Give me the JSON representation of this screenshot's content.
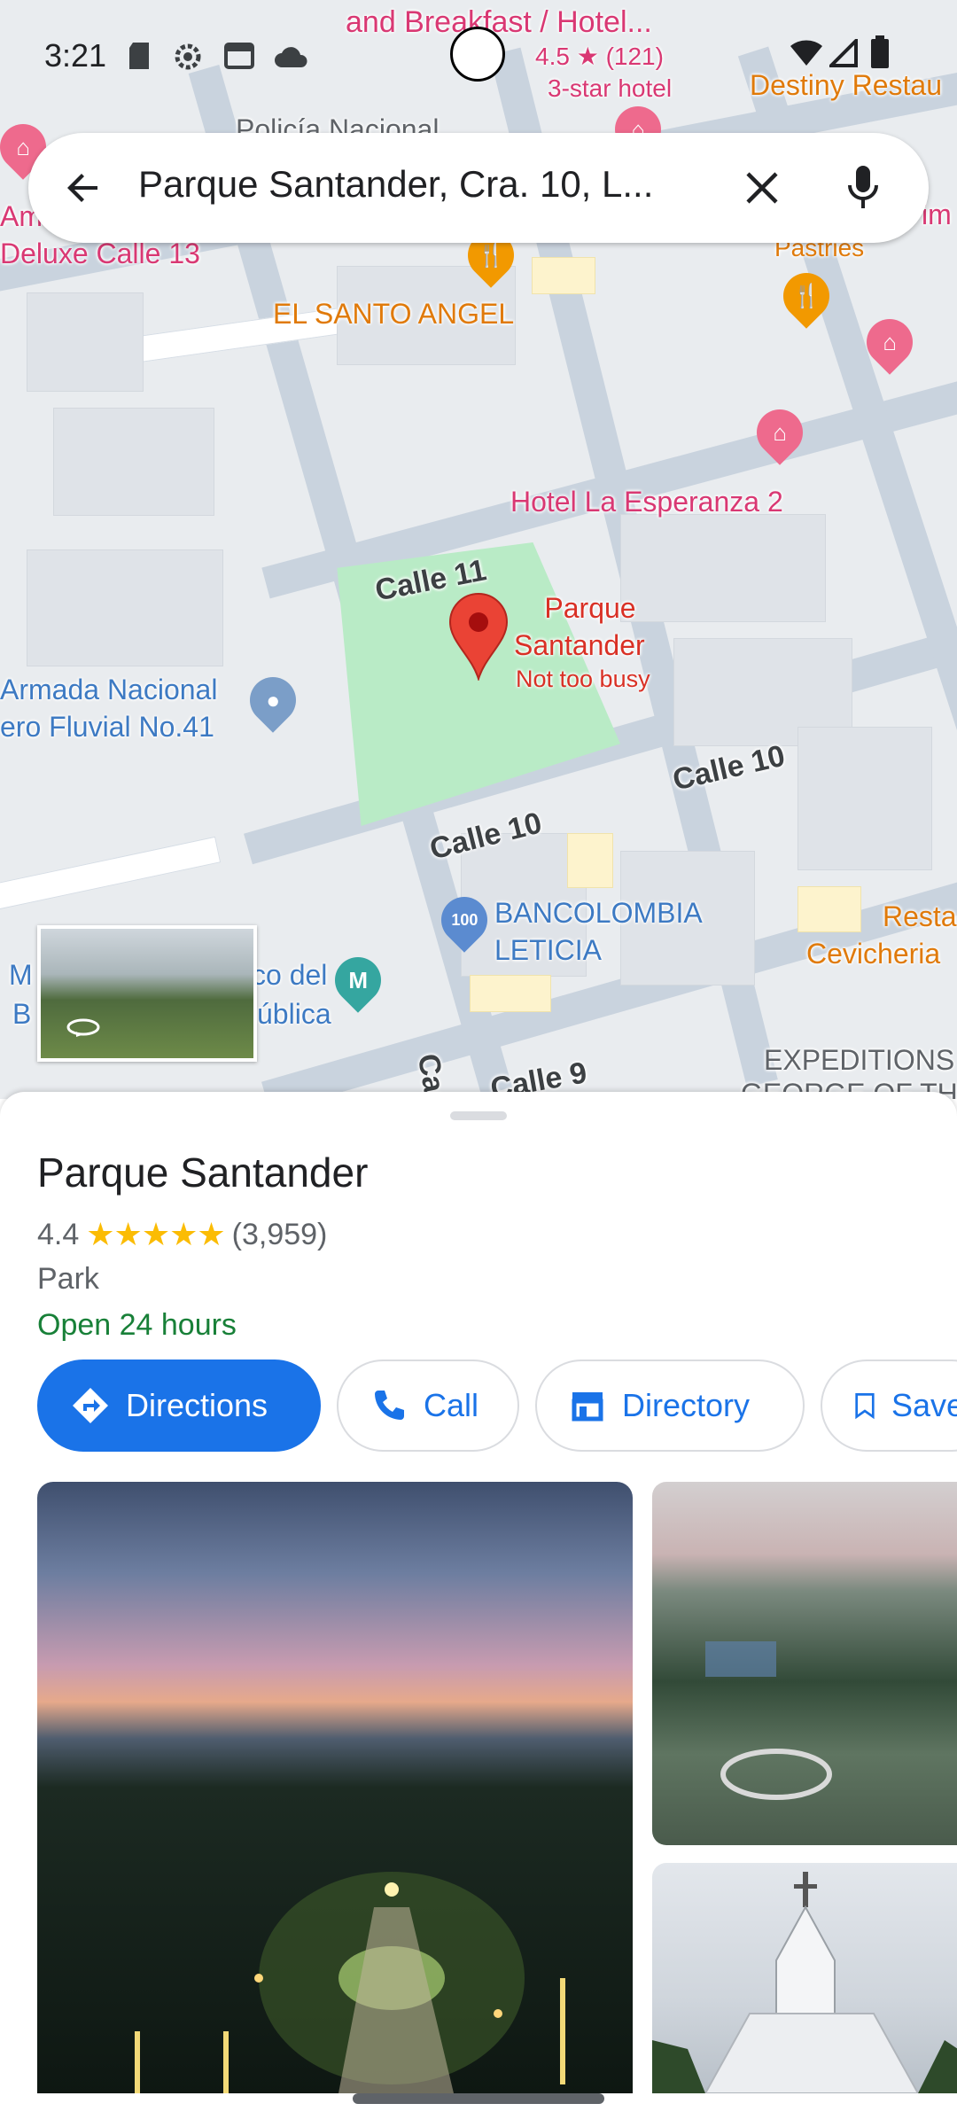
{
  "status_bar": {
    "time": "3:21"
  },
  "search": {
    "query": "Parque Santander, Cra. 10, L..."
  },
  "map": {
    "top_hotel": {
      "name": "and Breakfast / Hotel...",
      "rating": "4.5 ★ (121)",
      "class": "3-star hotel"
    },
    "labels": {
      "destiny": "Destiny Restau",
      "policia": "Policía Nacional",
      "deluxe_a": "Am",
      "deluxe_b": "Deluxe Calle 13",
      "pastries": "Pastries",
      "right_edge": "im",
      "santo_angel": "EL SANTO ANGEL",
      "esperanza": "Hotel La Esperanza 2",
      "park_name_1": "Parque",
      "park_name_2": "Santander",
      "park_busy": "Not too busy",
      "armada_1": "Armada Nacional",
      "armada_2": "ero Fluvial No.41",
      "bank_1": "BANCOLOMBIA",
      "bank_2": "LETICIA",
      "museo_a1": "M",
      "museo_a2": "B",
      "museo_b1": "co del",
      "museo_b2": "ública",
      "resta_1": "Resta",
      "resta_2": "Cevicheria",
      "expeditions": "EXPEDITIONS",
      "expeditions_2": "GEORGE OF THE",
      "calle11": "Calle 11",
      "calle10a": "Calle 10",
      "calle10b": "Calle 10",
      "calle9": "Calle 9",
      "carrera": "Car"
    }
  },
  "place": {
    "name": "Parque Santander",
    "rating": "4.4",
    "stars": "★★★★★",
    "reviews": "(3,959)",
    "category": "Park",
    "hours": "Open 24 hours"
  },
  "actions": {
    "directions": "Directions",
    "call": "Call",
    "directory": "Directory",
    "save": "Save"
  },
  "colors": {
    "accent": "#1a73e8",
    "open_green": "#188038",
    "star_yellow": "#fbbc04",
    "pin_red": "#ea4335",
    "park_green": "#b9ebc6"
  }
}
